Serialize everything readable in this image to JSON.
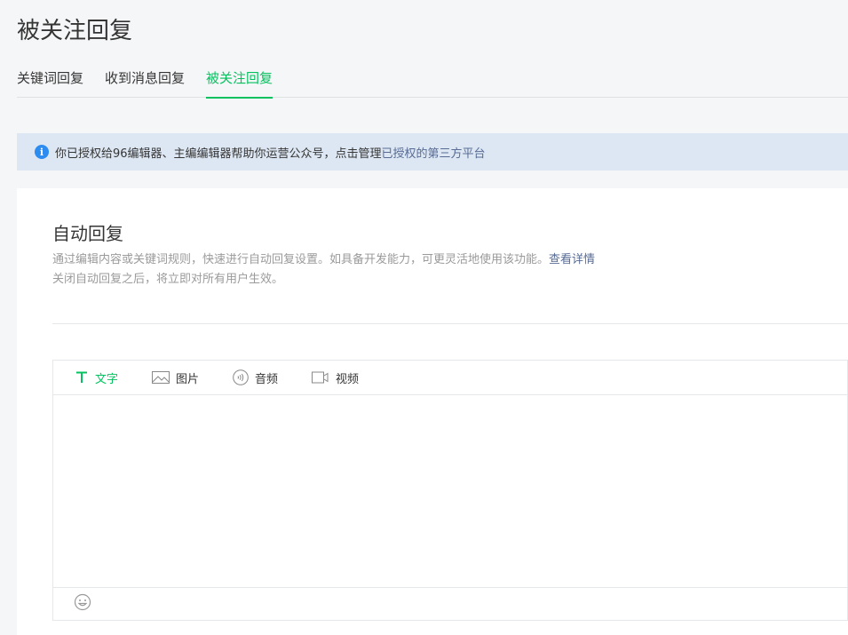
{
  "page": {
    "title": "被关注回复"
  },
  "tabs": [
    {
      "label": "关键词回复",
      "active": false
    },
    {
      "label": "收到消息回复",
      "active": false
    },
    {
      "label": "被关注回复",
      "active": true
    }
  ],
  "notice": {
    "text": "你已授权给96编辑器、主编编辑器帮助你运营公众号，点击管理",
    "link": "已授权的第三方平台"
  },
  "card": {
    "title": "自动回复",
    "desc_line1": "通过编辑内容或关键词规则，快速进行自动回复设置。如具备开发能力，可更灵活地使用该功能。",
    "desc_link": "查看详情",
    "desc_line2": "关闭自动回复之后，将立即对所有用户生效。"
  },
  "editor": {
    "tools": [
      {
        "label": "文字",
        "icon": "text-icon",
        "active": true
      },
      {
        "label": "图片",
        "icon": "image-icon",
        "active": false
      },
      {
        "label": "音频",
        "icon": "audio-icon",
        "active": false
      },
      {
        "label": "视频",
        "icon": "video-icon",
        "active": false
      }
    ],
    "emoji_icon": "emoji-icon"
  },
  "colors": {
    "accent": "#07c160",
    "link": "#576b95",
    "notice_bg": "#dde7f3",
    "info_icon": "#2d8cf0"
  }
}
